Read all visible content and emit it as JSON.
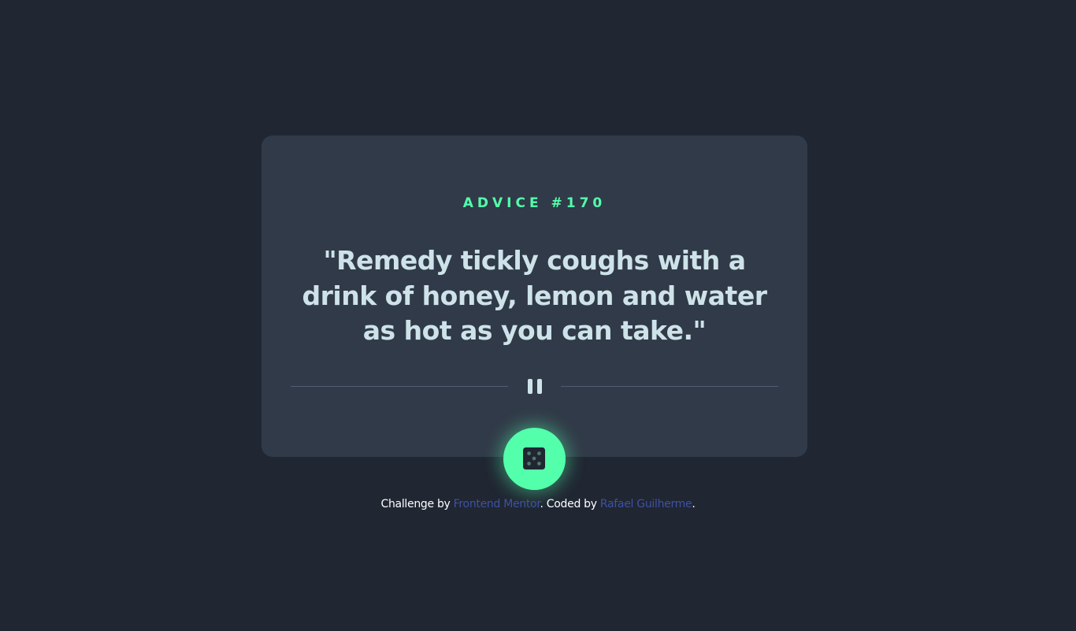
{
  "card": {
    "advice_label": "ADVICE #170",
    "quote": "\"Remedy tickly coughs with a drink of honey, lemon and water as hot as you can take.\""
  },
  "controls": {
    "pause_icon": "pause-icon",
    "dice_icon": "dice-icon"
  },
  "footer": {
    "prefix": "Challenge by ",
    "challenge_link": "Frontend Mentor",
    "middle": ". Coded by ",
    "author_link": "Rafael Guilherme",
    "suffix": "."
  },
  "colors": {
    "background": "#202632",
    "card": "#313a48",
    "accent": "#53ffab",
    "quote_text": "#cee3e9",
    "link": "#3e52a3",
    "divider": "#4f5d74"
  }
}
